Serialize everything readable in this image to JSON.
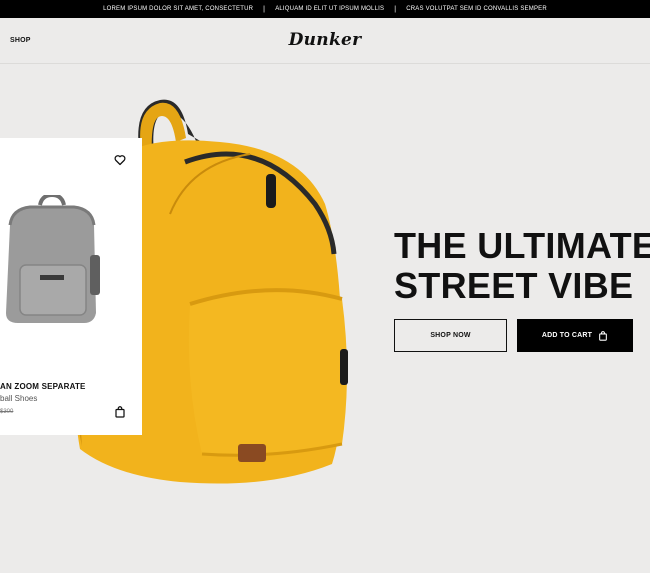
{
  "topbar": {
    "items": [
      "LOREM IPSUM DOLOR SIT AMET, CONSECTETUR",
      "ALIQUAM ID ELIT UT IPSUM MOLLIS",
      "CRAS VOLUTPAT SEM ID CONVALLIS SEMPER"
    ],
    "separator": "|"
  },
  "header": {
    "nav_shop": "SHOP",
    "logo": "Dunker"
  },
  "product_card": {
    "name": "AN ZOOM SEPARATE",
    "subtitle": "ball Shoes",
    "price": "$300",
    "icons": {
      "wishlist": "heart-icon",
      "cart": "shopping-bag-icon"
    }
  },
  "hero": {
    "headline_line1": "THE ULTIMATE",
    "headline_line2": "STREET VIBE",
    "shop_now_label": "SHOP NOW",
    "add_to_cart_label": "ADD TO CART",
    "icons": {
      "add_to_cart": "shopping-bag-icon"
    }
  },
  "colors": {
    "background": "#ecebea",
    "topbar": "#000000",
    "accent_yellow": "#f2b31c",
    "primary_button": "#000000"
  }
}
